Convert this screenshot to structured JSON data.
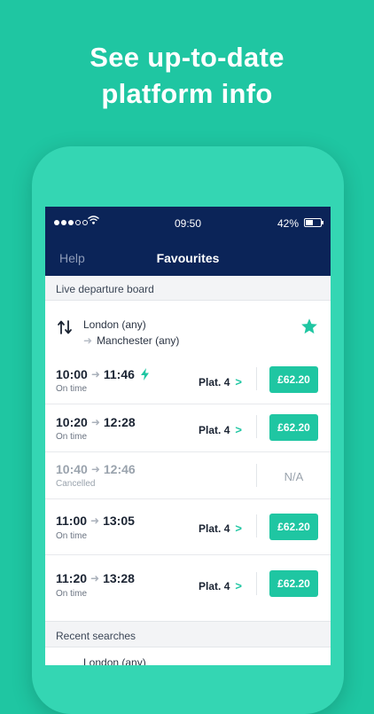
{
  "headline": {
    "line1": "See up-to-date",
    "line2": "platform info"
  },
  "status_bar": {
    "time": "09:50",
    "battery": "42%",
    "battery_level": 0.42
  },
  "navbar": {
    "back_label": "Help",
    "title": "Favourites"
  },
  "live_board": {
    "header": "Live departure board",
    "route": {
      "from": "London (any)",
      "to": "Manchester (any)",
      "favourite": true
    },
    "departures": [
      {
        "depart": "10:00",
        "arrive": "11:46",
        "fast": true,
        "status": "On time",
        "platform": "Plat. 4",
        "price": "£62.20"
      },
      {
        "depart": "10:20",
        "arrive": "12:28",
        "fast": false,
        "status": "On time",
        "platform": "Plat. 4",
        "price": "£62.20"
      },
      {
        "depart": "10:40",
        "arrive": "12:46",
        "fast": false,
        "status": "Cancelled",
        "platform": "",
        "price": "N/A"
      },
      {
        "depart": "11:00",
        "arrive": "13:05",
        "fast": false,
        "status": "On time",
        "platform": "Plat. 4",
        "price": "£62.20"
      },
      {
        "depart": "11:20",
        "arrive": "13:28",
        "fast": false,
        "status": "On time",
        "platform": "Plat. 4",
        "price": "£62.20"
      }
    ]
  },
  "recent": {
    "header": "Recent searches",
    "first_item": "London (any)"
  },
  "colors": {
    "accent": "#1fc6a2",
    "navy": "#0b2458",
    "background": "#1fc6a2"
  }
}
